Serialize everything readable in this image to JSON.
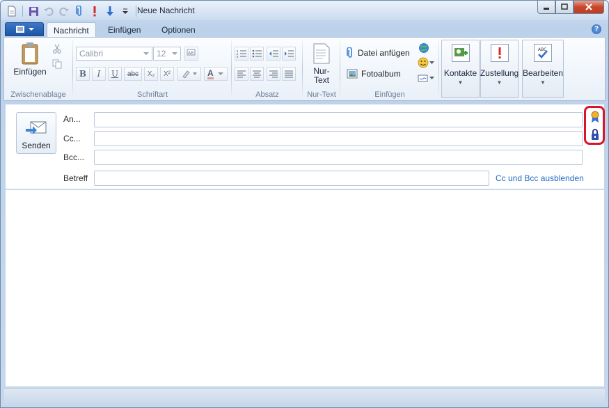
{
  "window": {
    "title": "Neue Nachricht"
  },
  "quick_access": {
    "icons": [
      "document-icon",
      "save-icon",
      "undo-icon",
      "redo-icon",
      "paperclip-icon",
      "exclamation-icon",
      "down-arrow-icon",
      "customize-dropdown-icon"
    ]
  },
  "tabs": [
    {
      "label": "Nachricht",
      "active": true
    },
    {
      "label": "Einfügen"
    },
    {
      "label": "Optionen"
    }
  ],
  "help": {
    "glyph": "?"
  },
  "ribbon": {
    "clipboard": {
      "paste_label": "Einfügen",
      "group_label": "Zwischenablage"
    },
    "font": {
      "font_name": "Calibri",
      "font_size": "12",
      "group_label": "Schriftart",
      "buttons": {
        "bold": "B",
        "italic": "I",
        "underline": "U",
        "strike": "abc",
        "subscript": "X₂",
        "superscript": "X²",
        "color": "A"
      }
    },
    "paragraph": {
      "group_label": "Absatz"
    },
    "plaintext": {
      "label_line1": "Nur-",
      "label_line2": "Text",
      "group_label": "Nur-Text"
    },
    "insert": {
      "attach_label": "Datei anfügen",
      "photo_label": "Fotoalbum",
      "group_label": "Einfügen"
    },
    "contacts": {
      "label": "Kontakte"
    },
    "delivery": {
      "label": "Zustellung"
    },
    "editing": {
      "label": "Bearbeiten"
    }
  },
  "compose": {
    "send_label": "Senden",
    "to_label": "An...",
    "cc_label": "Cc...",
    "bcc_label": "Bcc...",
    "subject_label": "Betreff",
    "toggle_cc_bcc": "Cc und Bcc ausblenden",
    "to_value": "",
    "cc_value": "",
    "bcc_value": "",
    "subject_value": ""
  },
  "colors": {
    "accent": "#1d55a3",
    "link": "#1f6bc2",
    "highlight": "#d8162a"
  }
}
